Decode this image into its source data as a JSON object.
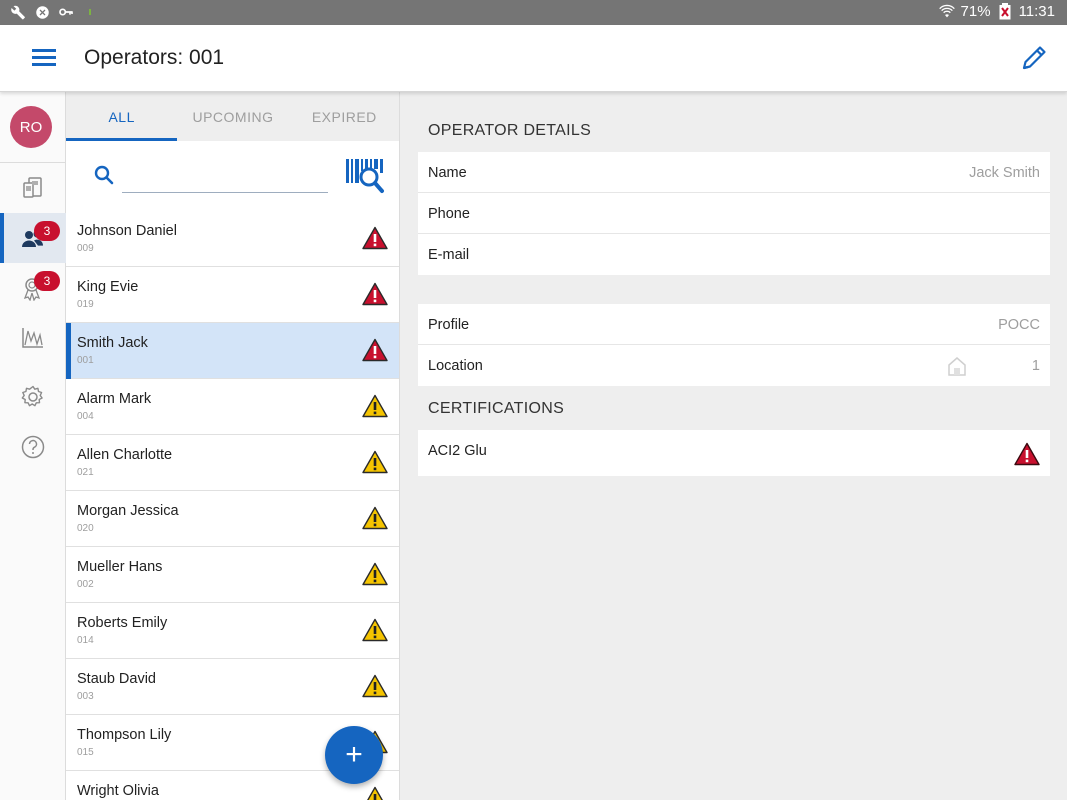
{
  "status_bar": {
    "battery": "71%",
    "time": "11:31",
    "left_icons": [
      "wrench-icon",
      "android-icon",
      "key-icon"
    ]
  },
  "app_bar": {
    "title": "Operators: 001"
  },
  "rail": {
    "avatar_initials": "RO",
    "items": [
      {
        "icon": "devices-icon",
        "badge": ""
      },
      {
        "icon": "operators-icon",
        "badge": "3"
      },
      {
        "icon": "certification-icon",
        "badge": "3"
      },
      {
        "icon": "chart-icon",
        "badge": ""
      },
      {
        "icon": "settings-icon",
        "badge": ""
      },
      {
        "icon": "help-icon",
        "badge": ""
      }
    ]
  },
  "tabs": [
    {
      "label": "ALL"
    },
    {
      "label": "UPCOMING"
    },
    {
      "label": "EXPIRED"
    }
  ],
  "search": {
    "value": "",
    "placeholder": ""
  },
  "operators": [
    {
      "name": "Johnson Daniel",
      "id": "009",
      "status": "expired"
    },
    {
      "name": "King Evie",
      "id": "019",
      "status": "expired"
    },
    {
      "name": "Smith Jack",
      "id": "001",
      "status": "expired"
    },
    {
      "name": "Alarm Mark",
      "id": "004",
      "status": "upcoming"
    },
    {
      "name": "Allen Charlotte",
      "id": "021",
      "status": "upcoming"
    },
    {
      "name": "Morgan Jessica",
      "id": "020",
      "status": "upcoming"
    },
    {
      "name": "Mueller Hans",
      "id": "002",
      "status": "upcoming"
    },
    {
      "name": "Roberts Emily",
      "id": "014",
      "status": "upcoming"
    },
    {
      "name": "Staub David",
      "id": "003",
      "status": "upcoming"
    },
    {
      "name": "Thompson Lily",
      "id": "015",
      "status": "upcoming"
    },
    {
      "name": "Wright Olivia",
      "id": "",
      "status": "upcoming"
    }
  ],
  "details": {
    "operator_title": "OPERATOR DETAILS",
    "name_label": "Name",
    "name_value": "Jack Smith",
    "phone_label": "Phone",
    "email_label": "E-mail",
    "profile_label": "Profile",
    "profile_value": "POCC",
    "location_label": "Location",
    "location_value": "1",
    "certifications_title": "CERTIFICATIONS",
    "certifications": [
      {
        "name": "ACI2 Glu",
        "status": "expired"
      }
    ]
  },
  "fab_label": "+",
  "colors": {
    "accent": "#1565c0",
    "expired_red": "#c8102e",
    "upcoming_yellow": "#f5c400",
    "avatar": "#c4496a"
  }
}
